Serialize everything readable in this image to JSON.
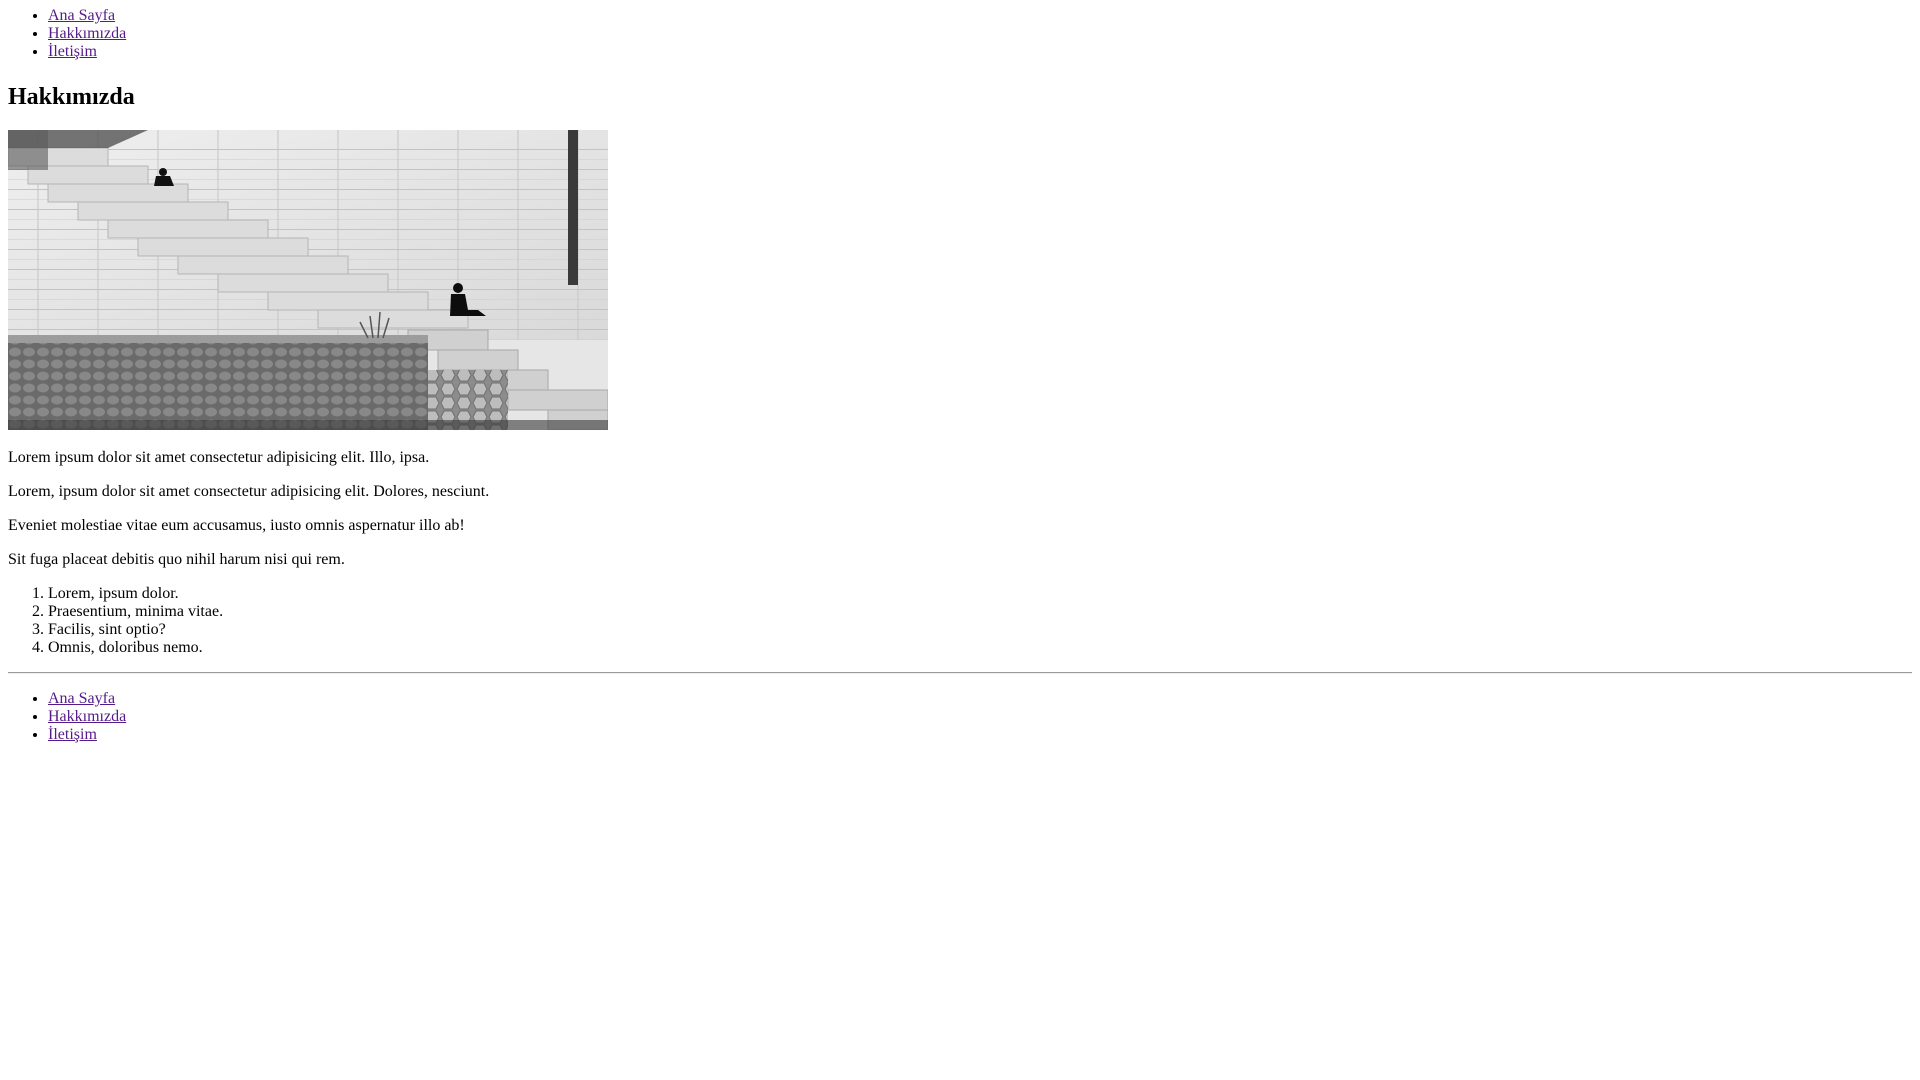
{
  "header_nav": {
    "items": [
      {
        "label": "Ana Sayfa"
      },
      {
        "label": "Hakkımızda"
      },
      {
        "label": "İletişim"
      }
    ]
  },
  "main": {
    "title": "Hakkımızda",
    "image": {
      "description": "black-and-white photo of stone stairs with two people sitting"
    },
    "paragraphs": [
      "Lorem ipsum dolor sit amet consectetur adipisicing elit. Illo, ipsa.",
      "Lorem, ipsum dolor sit amet consectetur adipisicing elit. Dolores, nesciunt.",
      "Eveniet molestiae vitae eum accusamus, iusto omnis aspernatur illo ab!",
      "Sit fuga placeat debitis quo nihil harum nisi qui rem."
    ],
    "ordered_list": [
      "Lorem, ipsum dolor.",
      "Praesentium, minima vitae.",
      "Facilis, sint optio?",
      "Omnis, doloribus nemo."
    ]
  },
  "footer_nav": {
    "items": [
      {
        "label": "Ana Sayfa"
      },
      {
        "label": "Hakkımızda"
      },
      {
        "label": "İletişim"
      }
    ]
  },
  "colors": {
    "link_visited": "#551a8b",
    "text": "#000000",
    "background": "#ffffff"
  }
}
